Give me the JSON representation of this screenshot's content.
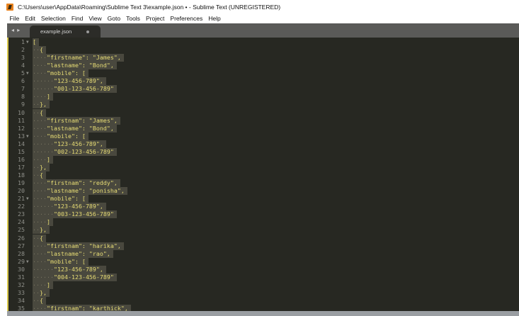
{
  "window": {
    "title": "C:\\Users\\user\\AppData\\Roaming\\Sublime Text 3\\example.json • - Sublime Text (UNREGISTERED)"
  },
  "menu": [
    "File",
    "Edit",
    "Selection",
    "Find",
    "View",
    "Goto",
    "Tools",
    "Project",
    "Preferences",
    "Help"
  ],
  "tab": {
    "label": "example.json",
    "nav": "◂ ▸"
  },
  "colors": {
    "editor_bg": "#272822",
    "string": "#e6db74",
    "selection": "#49483e"
  },
  "editor": {
    "fold_lines": [
      1,
      5,
      13,
      21,
      29
    ],
    "lines": [
      "[",
      "  {",
      "    \"firstname\": \"James\",",
      "    \"lastname\": \"Bond\",",
      "    \"mobile\": [",
      "      \"123-456-789\",",
      "      \"001-123-456-789\"",
      "    ]",
      "  },",
      "  {",
      "    \"firstnam\": \"James\",",
      "    \"lastname\": \"Bond\",",
      "    \"mobile\": [",
      "      \"123-456-789\",",
      "      \"002-123-456-789\"",
      "    ]",
      "  },",
      "  {",
      "    \"firstnam\": \"reddy\",",
      "    \"lastname\": \"ponisha\",",
      "    \"mobile\": [",
      "      \"123-456-789\",",
      "      \"003-123-456-789\"",
      "    ]",
      "  },",
      "  {",
      "    \"firstnam\": \"harika\",",
      "    \"lastname\": \"rao\",",
      "    \"mobile\": [",
      "      \"123-456-789\",",
      "      \"004-123-456-789\"",
      "    ]",
      "  },",
      "  {",
      "    \"firstnam\": \"karthick\","
    ]
  }
}
